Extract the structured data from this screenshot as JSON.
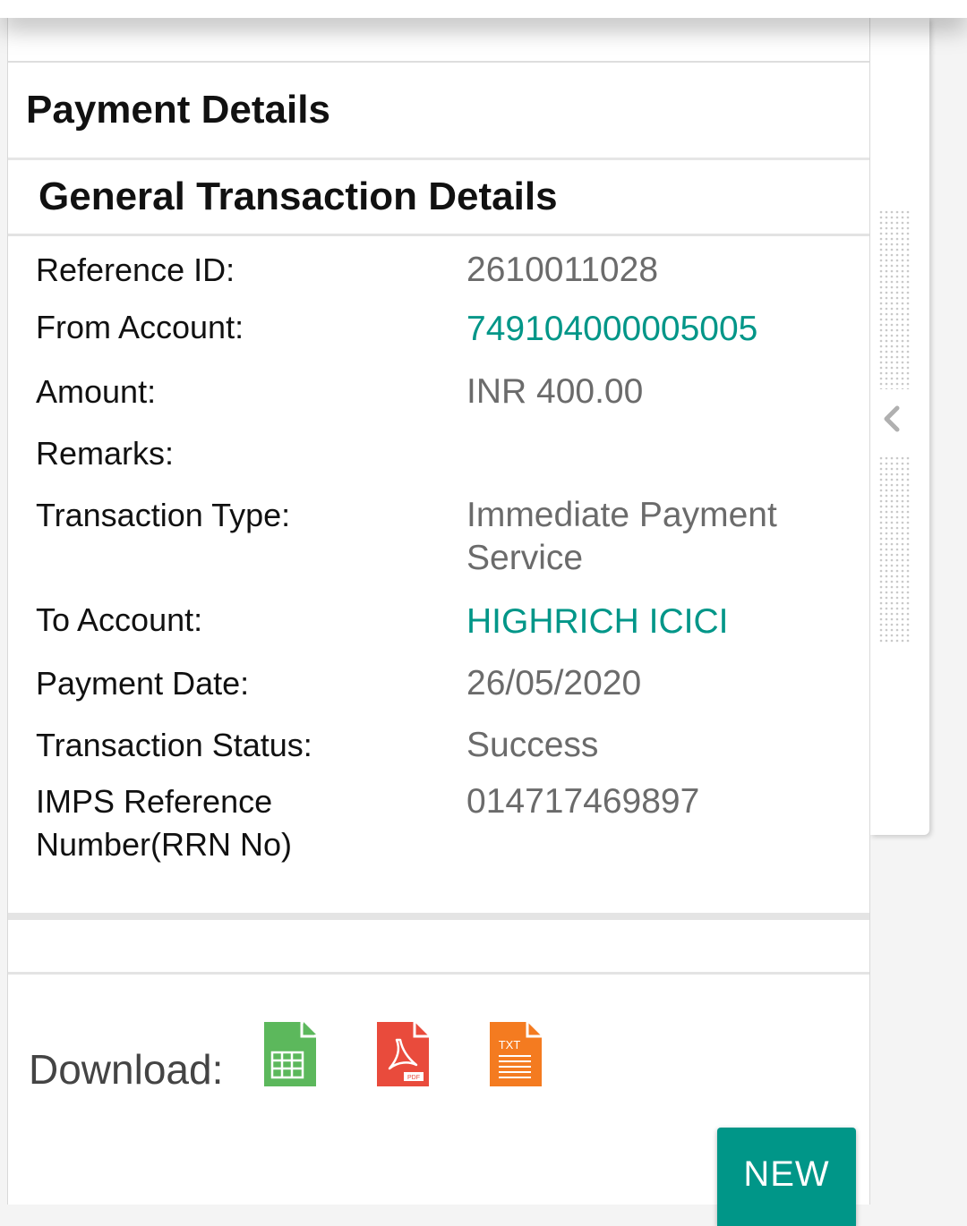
{
  "page": {
    "section_title": "Payment Details",
    "sub_title": "General Transaction Details"
  },
  "details": [
    {
      "label": "Reference ID:",
      "value": "2610011028",
      "value_style": "plain"
    },
    {
      "label": "From Account:",
      "value": "749104000005005",
      "value_style": "link"
    },
    {
      "label": "Amount:",
      "value": "INR 400.00",
      "value_style": "plain"
    },
    {
      "label": "Remarks:",
      "value": "",
      "value_style": "plain"
    },
    {
      "label": "Transaction Type:",
      "value": "Immediate Payment Service",
      "value_style": "plain"
    },
    {
      "label": "To Account:",
      "value": "HIGHRICH ICICI",
      "value_style": "link"
    },
    {
      "label": "Payment Date:",
      "value": "26/05/2020",
      "value_style": "plain"
    },
    {
      "label": "Transaction Status:",
      "value": "Success",
      "value_style": "plain"
    },
    {
      "label": "IMPS Reference Number(RRN No)",
      "value": "014717469897",
      "value_style": "plain"
    }
  ],
  "download": {
    "label": "Download:",
    "formats": [
      {
        "name": "excel-icon",
        "badge": ""
      },
      {
        "name": "pdf-icon",
        "badge": "PDF"
      },
      {
        "name": "txt-icon",
        "badge": "TXT"
      }
    ]
  },
  "new_button": {
    "label": "NEW"
  },
  "colors": {
    "accent": "#009688",
    "excel": "#5cb85c",
    "pdf": "#e94b3c",
    "txt": "#f47b20",
    "value_text": "#6b6b6b"
  }
}
